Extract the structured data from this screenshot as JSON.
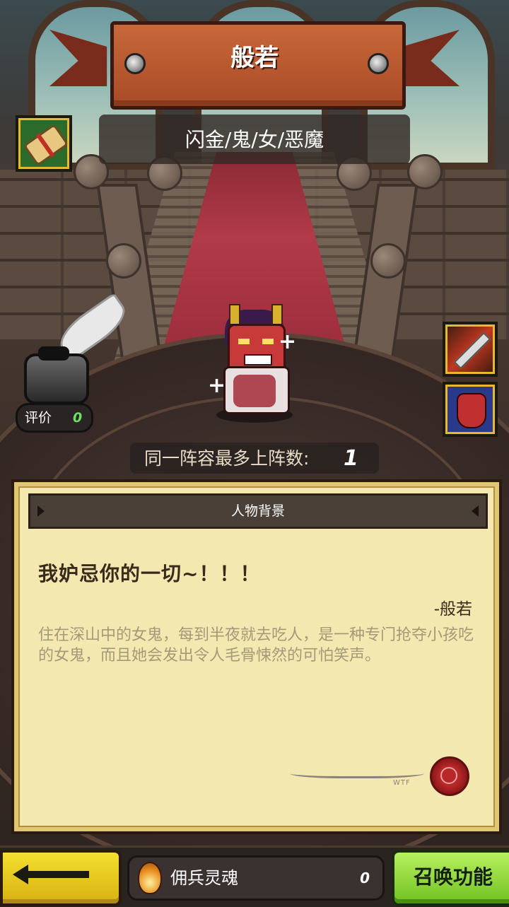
{
  "header": {
    "title": "般若",
    "tags": "闪金/鬼/女/恶魔"
  },
  "rating": {
    "label": "评价",
    "value": "0"
  },
  "team": {
    "max_label": "同一阵容最多上阵数:",
    "max_value": "1"
  },
  "panel": {
    "title": "人物背景",
    "quote": "我妒忌你的一切~！！！",
    "quote_by": "-般若",
    "description": "住在深山中的女鬼，每到半夜就去吃人，是一种专门抢夺小孩吃的女鬼，而且她会发出令人毛骨悚然的可怕笑声。",
    "signature_mark": "WTF"
  },
  "bottom": {
    "soul_label": "佣兵灵魂",
    "soul_value": "0",
    "summon_label": "召唤功能"
  },
  "icons": {
    "scroll": "scroll-icon",
    "inkwell": "quill-inkwell-icon",
    "skill1": "slash-skill-icon",
    "skill2": "oni-mask-skill-icon",
    "soul": "soul-flame-icon",
    "back": "back-arrow-icon"
  },
  "colors": {
    "banner": "#a84a26",
    "parchment": "#f2e8b0",
    "back_button": "#f4e030",
    "summon_button": "#8ad838",
    "rating_value": "#6de060"
  }
}
